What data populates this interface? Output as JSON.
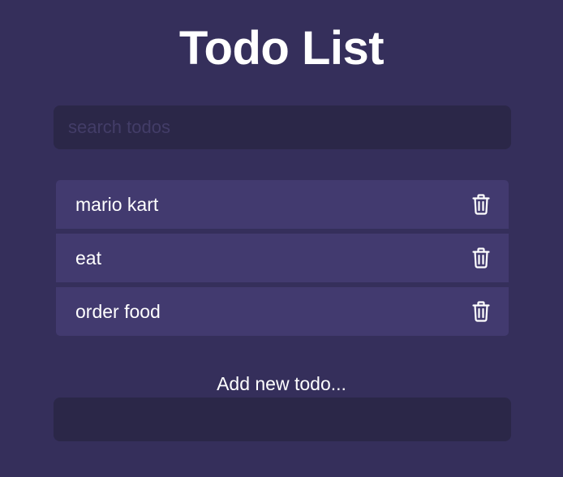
{
  "header": {
    "title": "Todo List"
  },
  "search": {
    "placeholder": "search todos",
    "value": ""
  },
  "todos": [
    {
      "text": "mario kart",
      "icon": "trash-icon"
    },
    {
      "text": "eat",
      "icon": "trash-icon"
    },
    {
      "text": "order food",
      "icon": "trash-icon"
    }
  ],
  "add_form": {
    "label": "Add new todo...",
    "value": ""
  },
  "colors": {
    "background": "#352f5b",
    "input_background": "#2b2748",
    "item_background": "#423a6f",
    "text": "#ffffff",
    "placeholder": "#433d68"
  }
}
